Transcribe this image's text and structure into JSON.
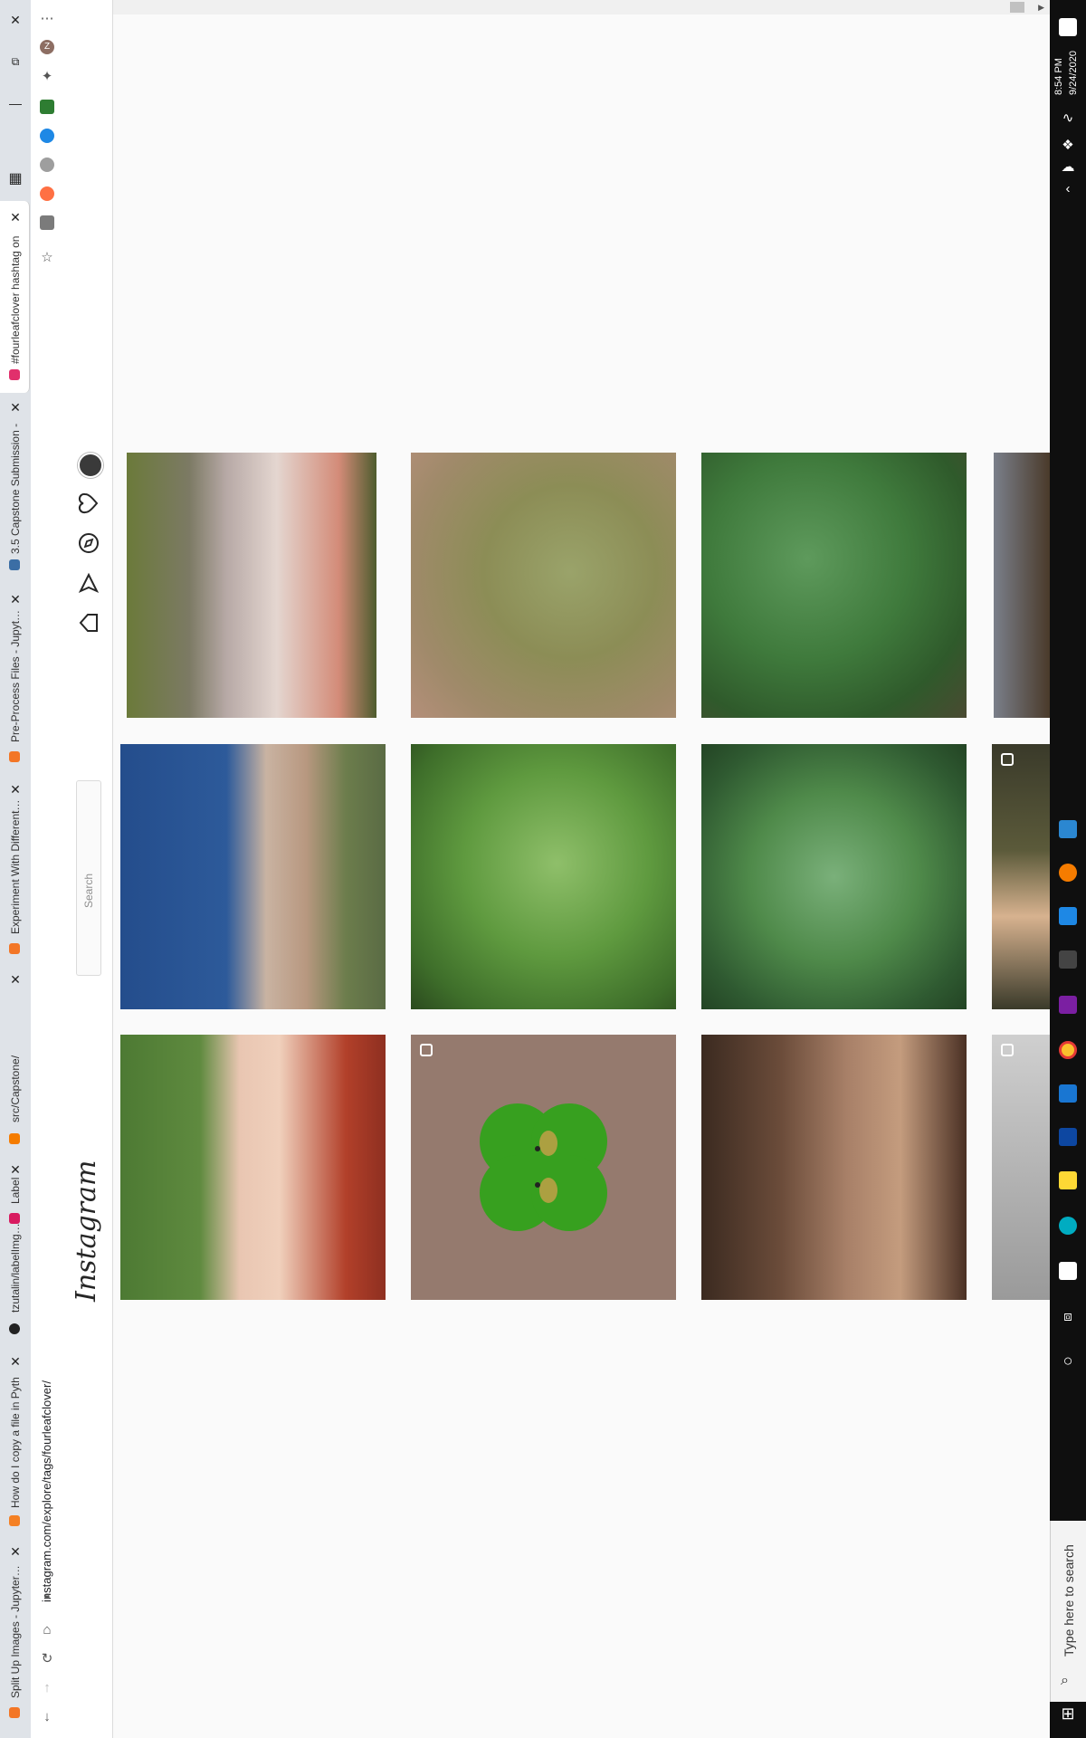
{
  "browser": {
    "window_controls": {
      "close": "✕",
      "restore": "⧉",
      "minimize": "—"
    },
    "tabs": [
      {
        "label": "#fourleafclover hashtag on",
        "favicon_color": "#e1306c",
        "active": true
      },
      {
        "label": "3.5 Capstone Submission -",
        "favicon_color": "#3b6ea5",
        "active": false
      },
      {
        "label": "Pre-Process Files - Jupyter N",
        "favicon_color": "#f37626",
        "active": false
      },
      {
        "label": "Experiment With Different Pr",
        "favicon_color": "#f37626",
        "active": false
      },
      {
        "label": "src/Capstone/",
        "favicon_color": "#f57c00",
        "active": false
      },
      {
        "label": "Label",
        "favicon_color": "#d81b60",
        "active": false
      },
      {
        "label": "tzutalin/labelImg: LabelI",
        "favicon_color": "#222222",
        "active": false
      },
      {
        "label": "How do I copy a file in Pyth",
        "favicon_color": "#f48024",
        "active": false
      },
      {
        "label": "Split Up Images - Jupyter No",
        "favicon_color": "#f37626",
        "active": false
      }
    ],
    "address": "instagram.com/explore/tags/fourleafclover/",
    "avatar_initial": "Z"
  },
  "instagram": {
    "logo": "Instagram",
    "search_placeholder": "Search",
    "nav_icons": [
      "home-icon",
      "direct-icon",
      "explore-icon",
      "activity-icon",
      "profile-avatar"
    ]
  },
  "grid": {
    "rows": 3,
    "columns_visible": 4,
    "posts": [
      {
        "desc": "crochet shawl",
        "multi": false
      },
      {
        "desc": "clover field blurred",
        "multi": false
      },
      {
        "desc": "clover patch",
        "multi": false
      },
      {
        "desc": "partial image",
        "multi": false
      },
      {
        "desc": "flower tattoo on arm",
        "multi": false
      },
      {
        "desc": "four leaf clover with purple flowers",
        "multi": false
      },
      {
        "desc": "clovers in grass",
        "multi": false
      },
      {
        "desc": "child partial",
        "multi": true
      },
      {
        "desc": "clover held in hands",
        "multi": false
      },
      {
        "desc": "cartoon clover",
        "multi": true
      },
      {
        "desc": "sepia portrait",
        "multi": false
      },
      {
        "desc": "partial image",
        "multi": true
      }
    ]
  },
  "taskbar": {
    "time": "8:54 PM",
    "date": "9/24/2020",
    "search_placeholder": "Type here to search"
  }
}
